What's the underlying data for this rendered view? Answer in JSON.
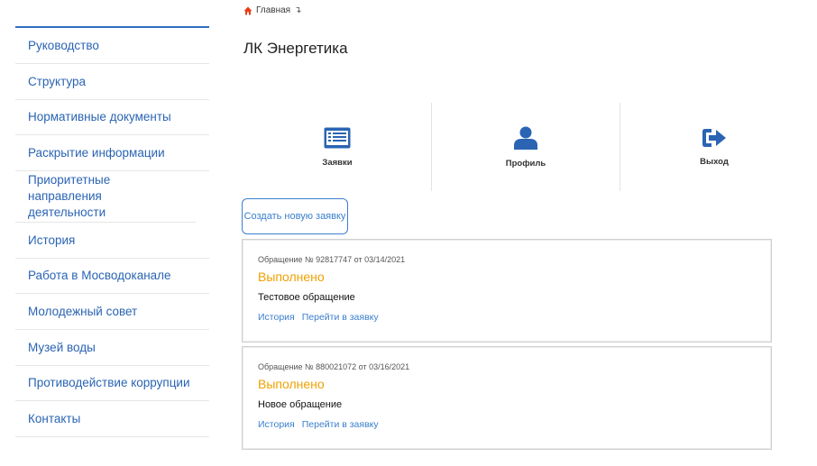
{
  "breadcrumb": {
    "home": "Главная",
    "arrow": "↴"
  },
  "sidebar": {
    "items": [
      {
        "label": "Руководство"
      },
      {
        "label": "Структура"
      },
      {
        "label": "Нормативные документы"
      },
      {
        "label": "Раскрытие информации"
      },
      {
        "label": "Приоритетные направления деятельности"
      },
      {
        "label": "История"
      },
      {
        "label": "Работа в Мосводоканале"
      },
      {
        "label": "Молодежный совет"
      },
      {
        "label": "Музей воды"
      },
      {
        "label": "Противодействие коррупции"
      },
      {
        "label": "Контакты"
      }
    ]
  },
  "page_title": "ЛК Энергетика",
  "tiles": [
    {
      "label": "Заявки",
      "icon": "list-icon"
    },
    {
      "label": "Профиль",
      "icon": "user-icon"
    },
    {
      "label": "Выход",
      "icon": "sign-out-icon"
    }
  ],
  "create_button": "Создать новую заявку",
  "requests": [
    {
      "meta": "Обращение № 92817747 от 03/14/2021",
      "status": "Выполнено",
      "subject": "Тестовое обращение",
      "history_link": "История",
      "open_link": "Перейти в заявку"
    },
    {
      "meta": "Обращение № 880021072 от 03/16/2021",
      "status": "Выполнено",
      "subject": "Новое обращение",
      "history_link": "История",
      "open_link": "Перейти в заявку"
    }
  ],
  "colors": {
    "accent": "#2a64b3",
    "status": "#f0a000",
    "home_icon": "#e8401c"
  }
}
